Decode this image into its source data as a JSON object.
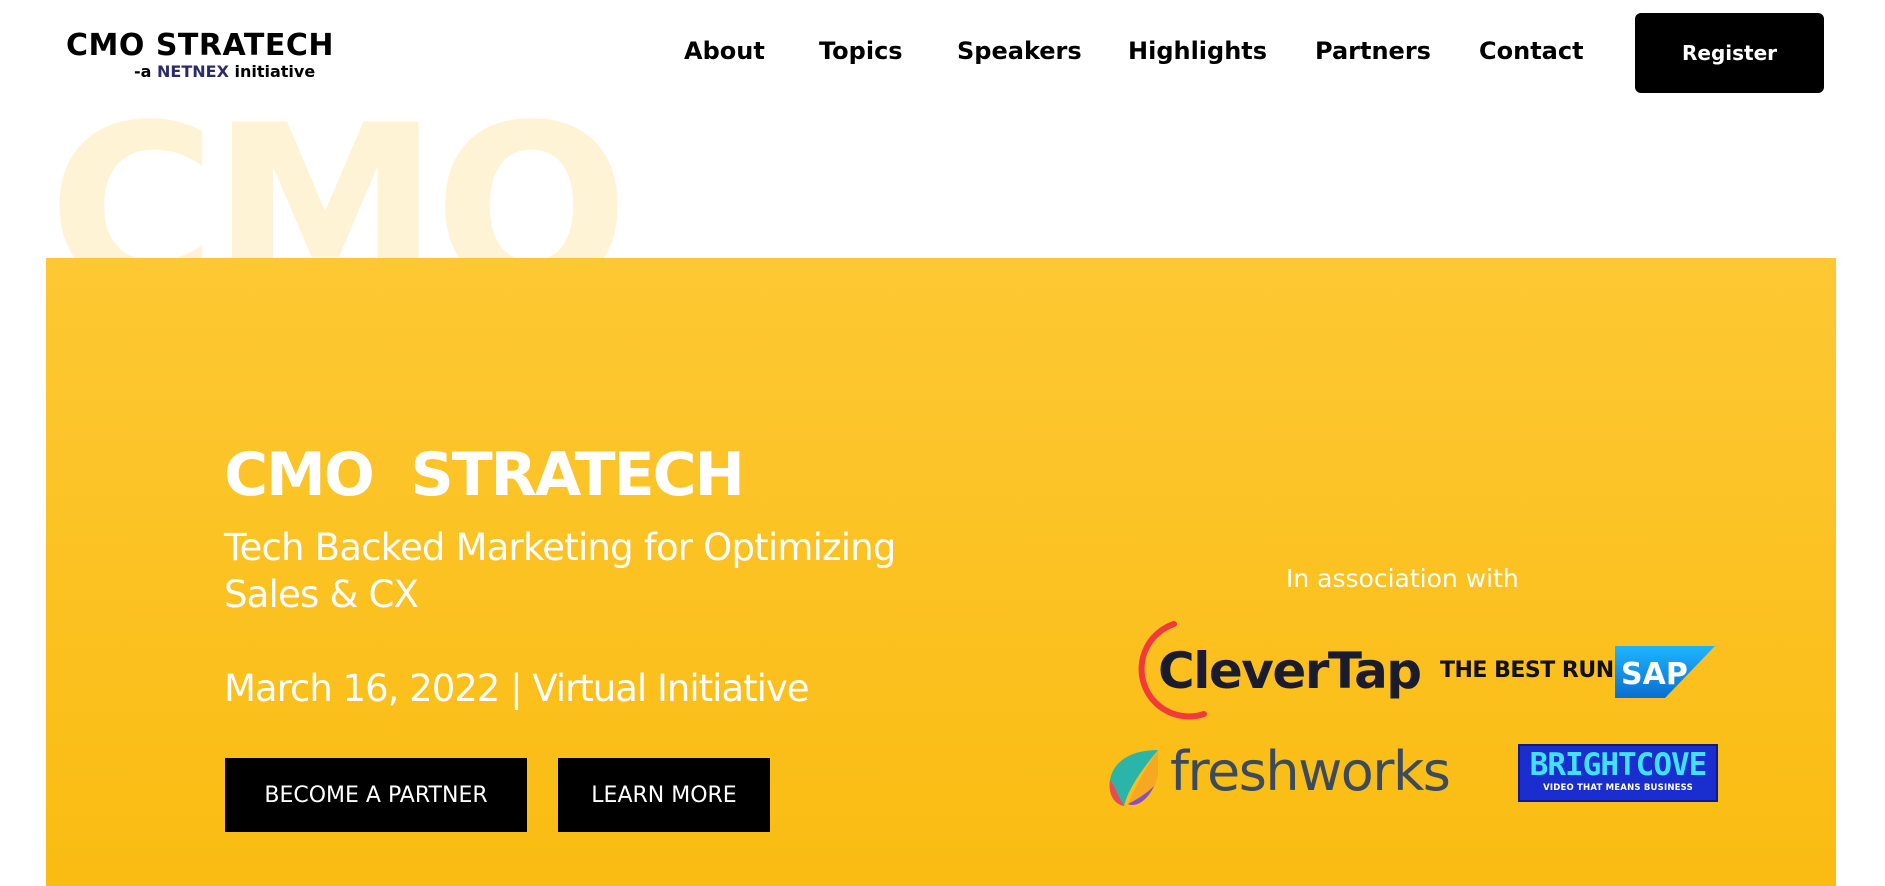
{
  "header": {
    "logo_main": "CMO STRATECH",
    "logo_sub_prefix": "-a",
    "logo_sub_brand": "NETNEX",
    "logo_sub_suffix": "initiative",
    "nav": [
      "About",
      "Topics",
      "Speakers",
      "Highlights",
      "Partners",
      "Contact"
    ],
    "register_label": "Register"
  },
  "watermark_text": "CMO",
  "hero": {
    "title": "CMO  STRATECH",
    "subtitle": "Tech Backed Marketing for Optimizing Sales & CX",
    "date_line": "March 16, 2022 | Virtual Initiative",
    "buttons": [
      "BECOME A PARTNER",
      "LEARN MORE"
    ]
  },
  "sponsors": {
    "heading": "In association with",
    "clevertap": "CleverTap",
    "sap_tagline": "THE BEST RUN",
    "sap_mark": "SAP",
    "freshworks": "freshworks",
    "brightcove_name": "BRIGHTCOVE",
    "brightcove_tag": "VIDEO THAT MEANS BUSINESS"
  },
  "colors": {
    "hero_top": "#fdc833",
    "hero_bottom": "#fabc12",
    "button_bg": "#000000",
    "watermark": "#fff3d6"
  }
}
